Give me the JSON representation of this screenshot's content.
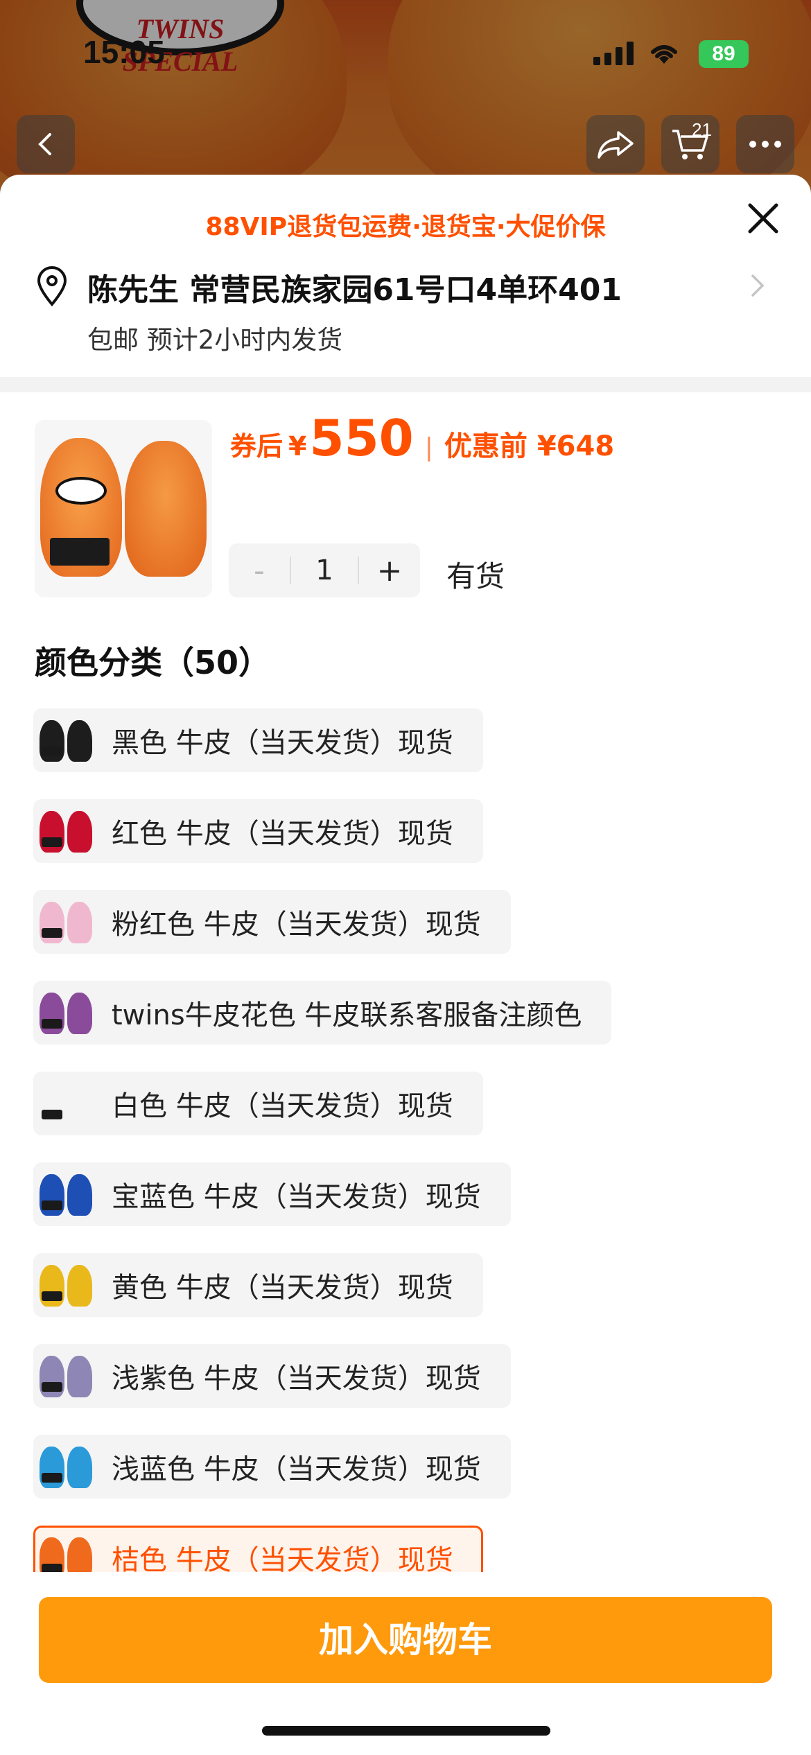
{
  "status_bar": {
    "time": "15:05",
    "battery": "89"
  },
  "nav": {
    "cart_count": "21",
    "icons": [
      "back-icon",
      "share-icon",
      "cart-icon",
      "more-icon"
    ]
  },
  "background": {
    "logo_text": "TWINS SPECIAL"
  },
  "sheet": {
    "promo": "88VIP退货包运费·退货宝·大促价保",
    "address": "陈先生 常营民族家园61号口4单环401",
    "shipping": "包邮 预计2小时内发货",
    "price": {
      "prefix": "券后",
      "yen": "¥",
      "amount": "550",
      "separator": "|",
      "original": "优惠前 ¥648"
    },
    "quantity": {
      "minus": "-",
      "value": "1",
      "plus": "+"
    },
    "stock": "有货",
    "section_title": "颜色分类（50）",
    "options": [
      {
        "label": "黑色 牛皮（当天发货）现货",
        "color": "#1d1d1d",
        "selected": false
      },
      {
        "label": "红色 牛皮（当天发货）现货",
        "color": "#c8102e",
        "selected": false
      },
      {
        "label": "粉红色 牛皮（当天发货）现货",
        "color": "#f0b8cf",
        "selected": false
      },
      {
        "label": "twins牛皮花色 牛皮联系客服备注颜色",
        "color": "#8a4c9a",
        "selected": false
      },
      {
        "label": "白色 牛皮（当天发货）现货",
        "color": "#f4f4f4",
        "selected": false
      },
      {
        "label": "宝蓝色 牛皮（当天发货）现货",
        "color": "#1e4fb4",
        "selected": false
      },
      {
        "label": "黄色 牛皮（当天发货）现货",
        "color": "#e9b81b",
        "selected": false
      },
      {
        "label": "浅紫色 牛皮（当天发货）现货",
        "color": "#8e86b4",
        "selected": false
      },
      {
        "label": "浅蓝色 牛皮（当天发货）现货",
        "color": "#2b9ad8",
        "selected": false
      },
      {
        "label": "桔色 牛皮（当天发货）现货",
        "color": "#f06a1e",
        "selected": true
      }
    ],
    "add_to_cart": "加入购物车"
  },
  "colors": {
    "accent": "#ff5000",
    "button": "#ff9a0c"
  }
}
